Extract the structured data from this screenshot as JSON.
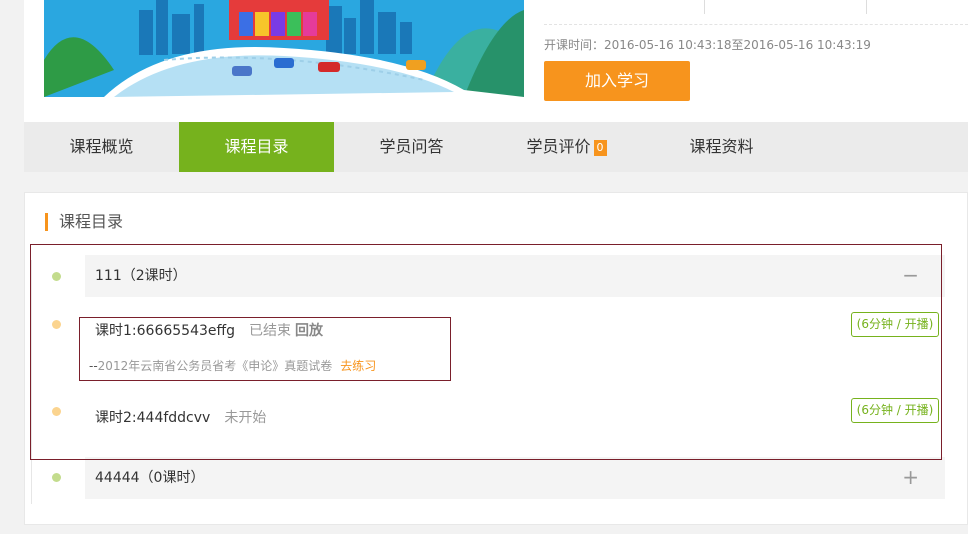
{
  "info": {
    "time_label": "开课时间：",
    "time_value": "2016-05-16 10:43:18至2016-05-16 10:43:19",
    "join_label": "加入学习"
  },
  "tabs": [
    {
      "label": "课程概览"
    },
    {
      "label": "课程目录",
      "active": true
    },
    {
      "label": "学员问答"
    },
    {
      "label": "学员评价",
      "badge": "0"
    },
    {
      "label": "课程资料"
    }
  ],
  "catalog": {
    "title": "课程目录",
    "chapters": [
      {
        "label": "111（2课时）",
        "toggle": "−"
      },
      {
        "label": "44444（0课时）",
        "toggle": "+"
      }
    ],
    "lessons": [
      {
        "title": "课时1:66665543effg",
        "status": "已结束",
        "action": "回放",
        "duration": "(6分钟 / 开播)"
      },
      {
        "title": "课时2:444fddcvv",
        "status": "未开始",
        "duration": "(6分钟 / 开播)"
      }
    ],
    "exercise": {
      "prefix": "--",
      "name": "2012年云南省公务员省考《申论》真题试卷",
      "action": "去练习"
    }
  },
  "colors": {
    "accent_green": "#76b21d",
    "accent_orange": "#f7941d",
    "highlight_border": "#7a1f2b"
  }
}
